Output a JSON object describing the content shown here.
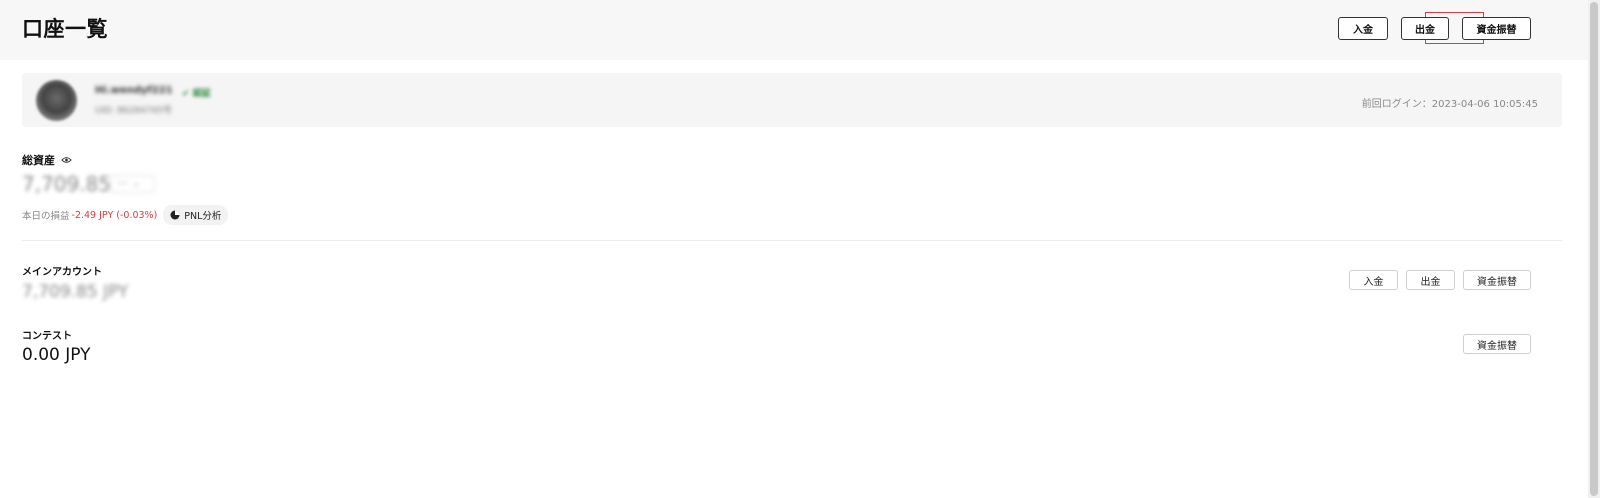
{
  "header": {
    "title": "口座一覧",
    "buttons": {
      "deposit": "入金",
      "withdraw": "出金",
      "transfer": "資金振替"
    }
  },
  "profile": {
    "username": "Hi.wendyf221",
    "verified": "認証",
    "uid": "UID: 86284745号",
    "last_login": "前回ログイン：2023-04-06 10:05:45"
  },
  "total_assets": {
    "label": "総資産",
    "value": "7,709.85",
    "currency": "JPY",
    "pnl_label": "本日の損益",
    "pnl_value": "-2.49 JPY (-0.03%)",
    "pnl_button": "PNL分析"
  },
  "accounts": [
    {
      "name": "メインアカウント",
      "balance": "7,709.85 JPY",
      "buttons": {
        "deposit": "入金",
        "withdraw": "出金",
        "transfer": "資金振替"
      }
    },
    {
      "name": "コンテスト",
      "balance": "0.00 JPY",
      "buttons": {
        "transfer": "資金振替"
      }
    }
  ],
  "colors": {
    "loss": "#e0393e",
    "highlight": "#e0393e"
  }
}
